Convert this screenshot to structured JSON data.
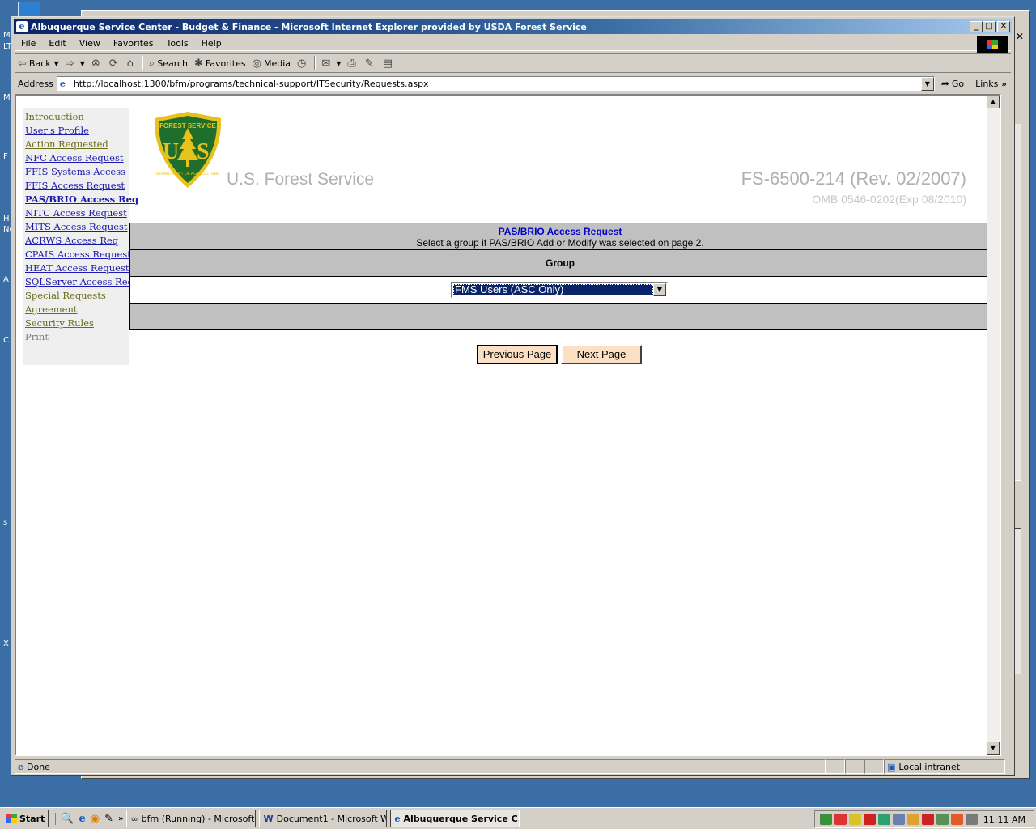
{
  "window": {
    "title": "Albuquerque Service Center - Budget & Finance - Microsoft Internet Explorer provided by USDA Forest Service"
  },
  "menu": [
    "File",
    "Edit",
    "View",
    "Favorites",
    "Tools",
    "Help"
  ],
  "toolbar": {
    "back": "Back",
    "search": "Search",
    "favorites": "Favorites",
    "media": "Media"
  },
  "address": {
    "label": "Address",
    "url": "http://localhost:1300/bfm/programs/technical-support/ITSecurity/Requests.aspx",
    "go": "Go",
    "links": "Links"
  },
  "nav": {
    "items": [
      {
        "label": "Introduction",
        "state": "visited"
      },
      {
        "label": "User's Profile",
        "state": "link"
      },
      {
        "label": "Action Requested",
        "state": "visited"
      },
      {
        "label": "NFC Access Request",
        "state": "link"
      },
      {
        "label": "FFIS Systems Access",
        "state": "link"
      },
      {
        "label": "FFIS Access Request",
        "state": "link"
      },
      {
        "label": "PAS/BRIO Access Req",
        "state": "current"
      },
      {
        "label": "NITC Access Request",
        "state": "link"
      },
      {
        "label": "MITS Access Request",
        "state": "link"
      },
      {
        "label": "ACRWS Access Req",
        "state": "link"
      },
      {
        "label": "CPAIS Access Request",
        "state": "link"
      },
      {
        "label": "HEAT Access Request",
        "state": "link"
      },
      {
        "label": "SQLServer Access Req",
        "state": "link"
      },
      {
        "label": "Special Requests",
        "state": "visited"
      },
      {
        "label": "Agreement",
        "state": "visited"
      },
      {
        "label": "Security Rules",
        "state": "visited"
      },
      {
        "label": "Print",
        "state": "disabled"
      }
    ]
  },
  "header": {
    "badge_top": "FOREST SERVICE",
    "badge_letters": "US",
    "badge_bottom": "DEPARTMENT OF AGRICULTURE",
    "org_name": "U.S. Forest Service",
    "form_id": "FS-6500-214 (Rev. 02/2007)",
    "omb": "OMB 0546-0202(Exp 08/2010)"
  },
  "form": {
    "title": "PAS/BRIO Access Request",
    "instruction": "Select a group if PAS/BRIO Add or Modify was selected on page 2.",
    "group_label": "Group",
    "group_value": "FMS Users (ASC Only)"
  },
  "buttons": {
    "previous": "Previous Page",
    "next": "Next Page"
  },
  "status": {
    "text": "Done",
    "zone": "Local intranet"
  },
  "taskbar": {
    "start": "Start",
    "tasks": [
      {
        "label": "bfm (Running) - Microsoft..."
      },
      {
        "label": "Document1 - Microsoft W..."
      },
      {
        "label": "Albuquerque Service C..."
      }
    ],
    "clock": "11:11 AM"
  },
  "colors": {
    "title_bar": "#0a246a",
    "link": "#1a1ab0",
    "visited_link": "#6b6b1a",
    "table_header_bg": "#c0c0c0",
    "table_title": "#0000cc",
    "button_bg": "#fbe0c4",
    "badge_green": "#1f6e2b",
    "badge_gold": "#e8c21c"
  }
}
